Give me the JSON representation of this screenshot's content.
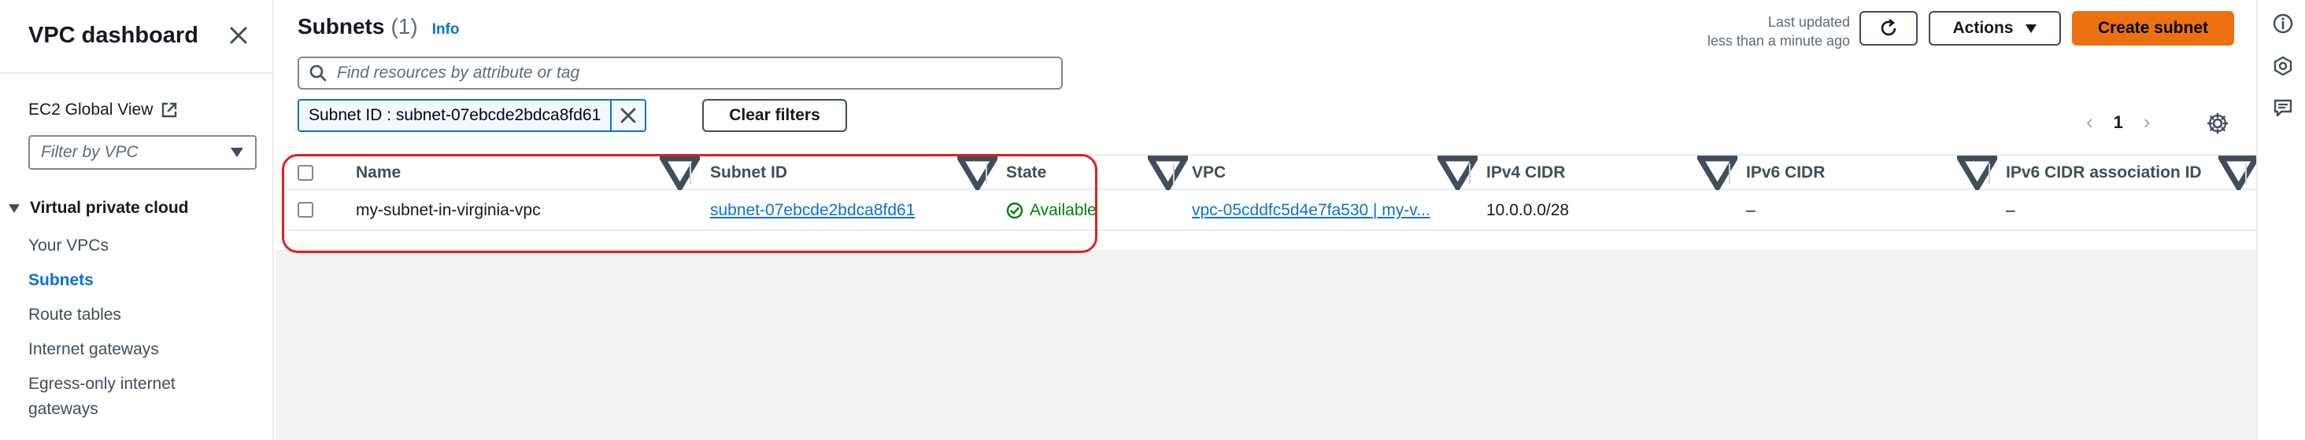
{
  "sidebar": {
    "title": "VPC dashboard",
    "ec2_global_view": "EC2 Global View",
    "filter_placeholder": "Filter by VPC",
    "section_title": "Virtual private cloud",
    "items": [
      {
        "label": "Your VPCs",
        "active": false
      },
      {
        "label": "Subnets",
        "active": true
      },
      {
        "label": "Route tables",
        "active": false
      },
      {
        "label": "Internet gateways",
        "active": false
      },
      {
        "label": "Egress-only internet",
        "active": false
      },
      {
        "label": "gateways",
        "active": false
      }
    ]
  },
  "header": {
    "title": "Subnets",
    "count": "(1)",
    "info": "Info",
    "last_updated_label": "Last updated",
    "last_updated_value": "less than a minute ago",
    "actions_label": "Actions",
    "create_label": "Create subnet"
  },
  "search": {
    "placeholder": "Find resources by attribute or tag"
  },
  "filter_token": {
    "text": "Subnet ID : subnet-07ebcde2bdca8fd61"
  },
  "clear_filters_label": "Clear filters",
  "pagination": {
    "current_page": "1"
  },
  "table": {
    "columns": [
      "Name",
      "Subnet ID",
      "State",
      "VPC",
      "IPv4 CIDR",
      "IPv6 CIDR",
      "IPv6 CIDR association ID"
    ],
    "rows": [
      {
        "name": "my-subnet-in-virginia-vpc",
        "subnet_id": "subnet-07ebcde2bdca8fd61",
        "state": "Available",
        "vpc": "vpc-05cddfc5d4e7fa530 | my-v...",
        "ipv4_cidr": "10.0.0.0/28",
        "ipv6_cidr": "–",
        "ipv6_assoc": "–"
      }
    ]
  },
  "colors": {
    "accent": "#0972d3",
    "primary_button": "#ec7211",
    "available": "#037f0c",
    "highlight": "#e02020"
  },
  "icons": [
    "close-icon",
    "external-link-icon",
    "caret-down-icon",
    "search-icon",
    "refresh-icon",
    "dismiss-icon",
    "chevron-left-icon",
    "chevron-right-icon",
    "gear-icon",
    "sort-icon",
    "status-available-icon",
    "info-icon",
    "tools-icon",
    "feedback-icon"
  ]
}
